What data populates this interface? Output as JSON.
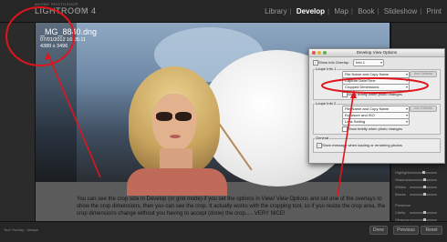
{
  "app": {
    "brand_small": "ADOBE PHOTOSHOP",
    "brand_name": "LIGHTROOM 4",
    "brand_tag": "BETA"
  },
  "modules": [
    "Library",
    "Develop",
    "Map",
    "Book",
    "Slideshow",
    "Print"
  ],
  "active_module": "Develop",
  "info_overlay": {
    "filename": "_MG_8840.dng",
    "datetime": "07/01/2012 16:05:11",
    "dimensions": "4389 x 3496"
  },
  "dialog": {
    "title": "Develop View Options",
    "show_info_overlay_label": "Show Info Overlay:",
    "info_select": "Info 1",
    "loupe_info_1_label": "Loupe Info 1",
    "loupe_info_2_label": "Loupe Info 2",
    "info1_rows": [
      "File Name and Copy Name",
      "Capture Date/Time",
      "Cropped Dimensions"
    ],
    "info2_rows": [
      "File Name and Copy Name",
      "Exposure and ISO",
      "Lens Setting"
    ],
    "use_defaults": "Use Defaults",
    "show_briefly_1": "Show briefly when photo changes",
    "show_briefly_2": "Show briefly when photo changes",
    "general_label": "General",
    "show_message": "Show message when loading or rendering photos"
  },
  "caption": "You can see the crop size in Develop (or grid mode) if you set the options in View/ View Options and set one of the overlays to show the crop dimensions, then you can see the crop. It actually works with the cropping tool, so if you resize the crop area, the crop dimensions change without you having to accept (done) the crop..... VERY NICE!",
  "bottom": {
    "left_text": "Tool Overlay : Always",
    "done": "Done",
    "previous": "Previous",
    "reset": "Reset"
  },
  "right_panel": {
    "labels": [
      "Color",
      "Highlights",
      "Shadows",
      "Whites",
      "Blacks",
      "Presence",
      "Clarity",
      "Vibrance",
      "Saturation"
    ]
  },
  "colors": {
    "annotation": "#e0141c",
    "dialog_bg": "#e4e4e4",
    "toolbar_bg": "#262626"
  }
}
